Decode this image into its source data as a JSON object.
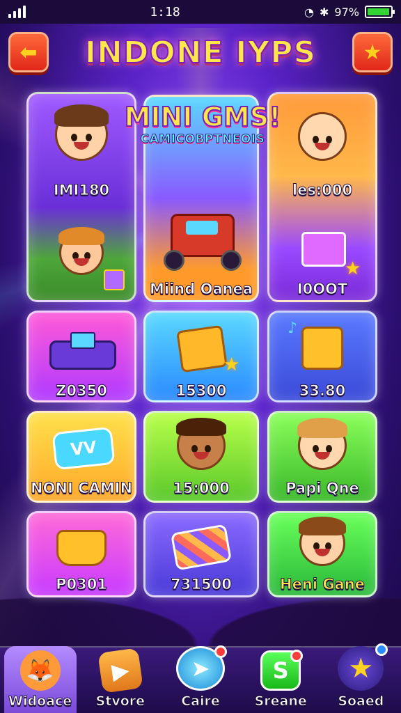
{
  "status_bar": {
    "time": "1:18",
    "battery_text": "97%",
    "battery_level": 0.97
  },
  "header": {
    "title": "INDONE IYPS",
    "back_icon": "arrow-left-icon",
    "favorite_icon": "star-icon"
  },
  "featured": {
    "line1": "MINI GMS!",
    "line2": "CAMICOBPTNEOIS"
  },
  "cards": [
    {
      "label": "IMI180",
      "theme": "purple"
    },
    {
      "label": "Miind Oanea",
      "theme": "cyan"
    },
    {
      "label": "les:000",
      "theme": "orange"
    },
    {
      "label": "I0OOT",
      "theme": "violet"
    },
    {
      "label": "Z0350",
      "theme": "magenta"
    },
    {
      "label": "15300",
      "theme": "blue"
    },
    {
      "label": "33.80",
      "theme": "blue2"
    },
    {
      "label": "NONI CAMIN",
      "theme": "yellow"
    },
    {
      "label": "15:000",
      "theme": "lime"
    },
    {
      "label": "Papi Qne",
      "theme": "green"
    },
    {
      "label": "P0301",
      "theme": "pink"
    },
    {
      "label": "731500",
      "theme": "indigo"
    },
    {
      "label": "Heni Gane",
      "theme": "green2"
    }
  ],
  "nav": {
    "items": [
      {
        "label": "Widoace",
        "icon": "fox-icon",
        "active": true
      },
      {
        "label": "Stvore",
        "icon": "store-icon"
      },
      {
        "label": "Caire",
        "icon": "play-icon",
        "badge": true
      },
      {
        "label": "Sreane",
        "icon": "s-icon",
        "badge": true
      },
      {
        "label": "Soaed",
        "icon": "star-icon",
        "badge": true
      }
    ]
  },
  "colors": {
    "accent": "#ffe64a",
    "header_button": "#e0271a",
    "background": "#5a23c8"
  }
}
